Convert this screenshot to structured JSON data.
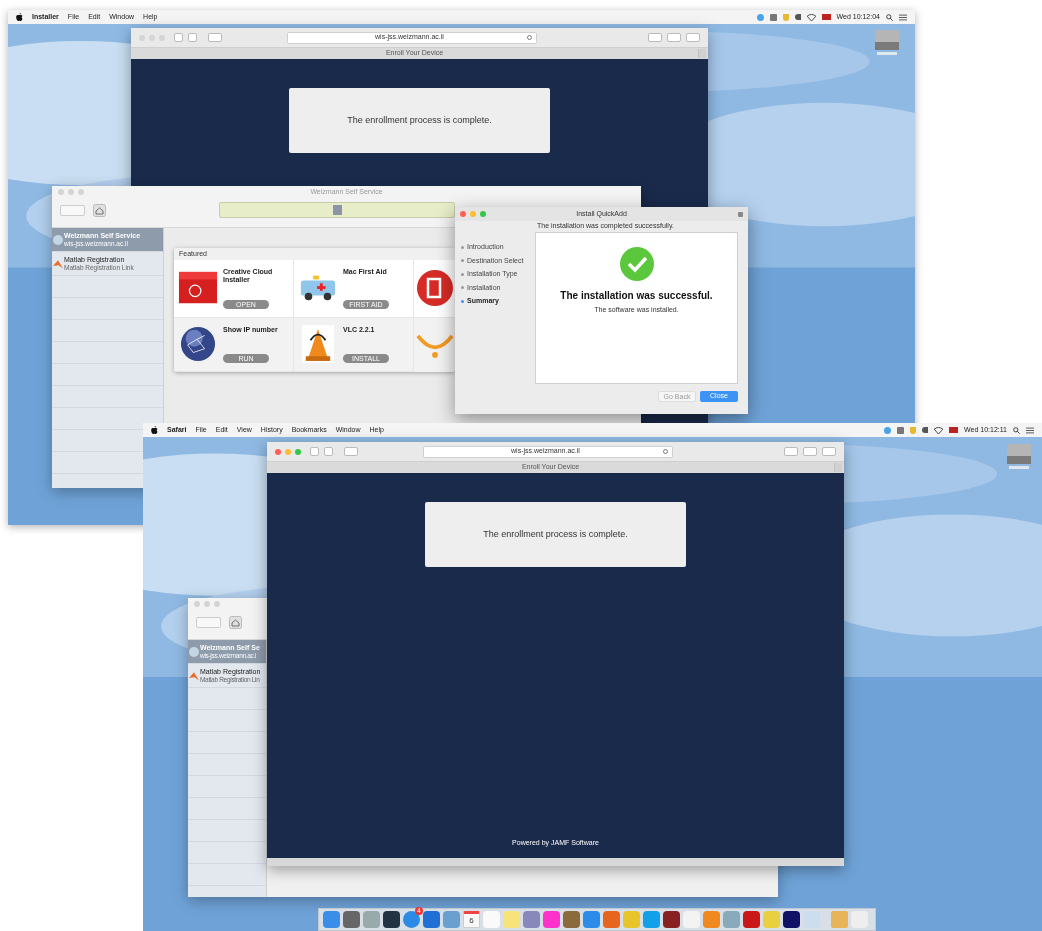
{
  "top": {
    "menu_bar": {
      "app": "Installer",
      "menus": [
        "File",
        "Edit",
        "Window",
        "Help"
      ],
      "clock": "Wed 10:12:04"
    },
    "safari": {
      "address": "wis-jss.weizmann.ac.il",
      "tab": "Enroll Your Device",
      "message": "The enrollment process is complete."
    },
    "self_service": {
      "title": "Weizmann Self Service",
      "sidebar": [
        {
          "name": "Weizmann Self Service",
          "subtitle": "wis-jss.weizmann.ac.il",
          "selected": true
        },
        {
          "name": "Matlab Registration",
          "subtitle": "Matlab Registration Link",
          "selected": false
        }
      ],
      "featured_title": "Featured",
      "items": [
        {
          "kind": "box",
          "name": "Creative Cloud Installer",
          "action": "OPEN"
        },
        {
          "kind": "ambulance",
          "name": "Mac First Aid",
          "action": "FIRST AID"
        },
        {
          "kind": "globe",
          "name": "Show IP number",
          "action": "RUN"
        },
        {
          "kind": "cone",
          "name": "VLC 2.2.1",
          "action": "INSTALL"
        }
      ]
    },
    "installer": {
      "title": "Install QuickAdd",
      "header": "The installation was completed successfully.",
      "steps": [
        {
          "label": "Introduction",
          "selected": false
        },
        {
          "label": "Destination Select",
          "selected": false
        },
        {
          "label": "Installation Type",
          "selected": false
        },
        {
          "label": "Installation",
          "selected": false
        },
        {
          "label": "Summary",
          "selected": true
        }
      ],
      "headline": "The installation was successful.",
      "detail": "The software was installed.",
      "buttons": [
        {
          "label": "Go Back",
          "disabled": true
        },
        {
          "label": "Close",
          "disabled": false
        }
      ]
    }
  },
  "bottom": {
    "menu_bar": {
      "app": "Safari",
      "menus": [
        "File",
        "Edit",
        "View",
        "History",
        "Bookmarks",
        "Window",
        "Help"
      ],
      "clock": "Wed 10:12:11"
    },
    "safari": {
      "address": "wis-jss.weizmann.ac.il",
      "tab": "Enroll Your Device",
      "message": "The enrollment process is complete.",
      "footer": "Powered by JAMF Software"
    },
    "self_service": {
      "sidebar": [
        {
          "name": "Weizmann Self Se",
          "subtitle": "wis-jss.weizmann.ac.i",
          "selected": true
        },
        {
          "name": "Matlab Registration",
          "subtitle": "Matlab Registration Lin",
          "selected": false
        }
      ]
    },
    "dock": {
      "badge": "4",
      "calendar_day": "6"
    }
  }
}
